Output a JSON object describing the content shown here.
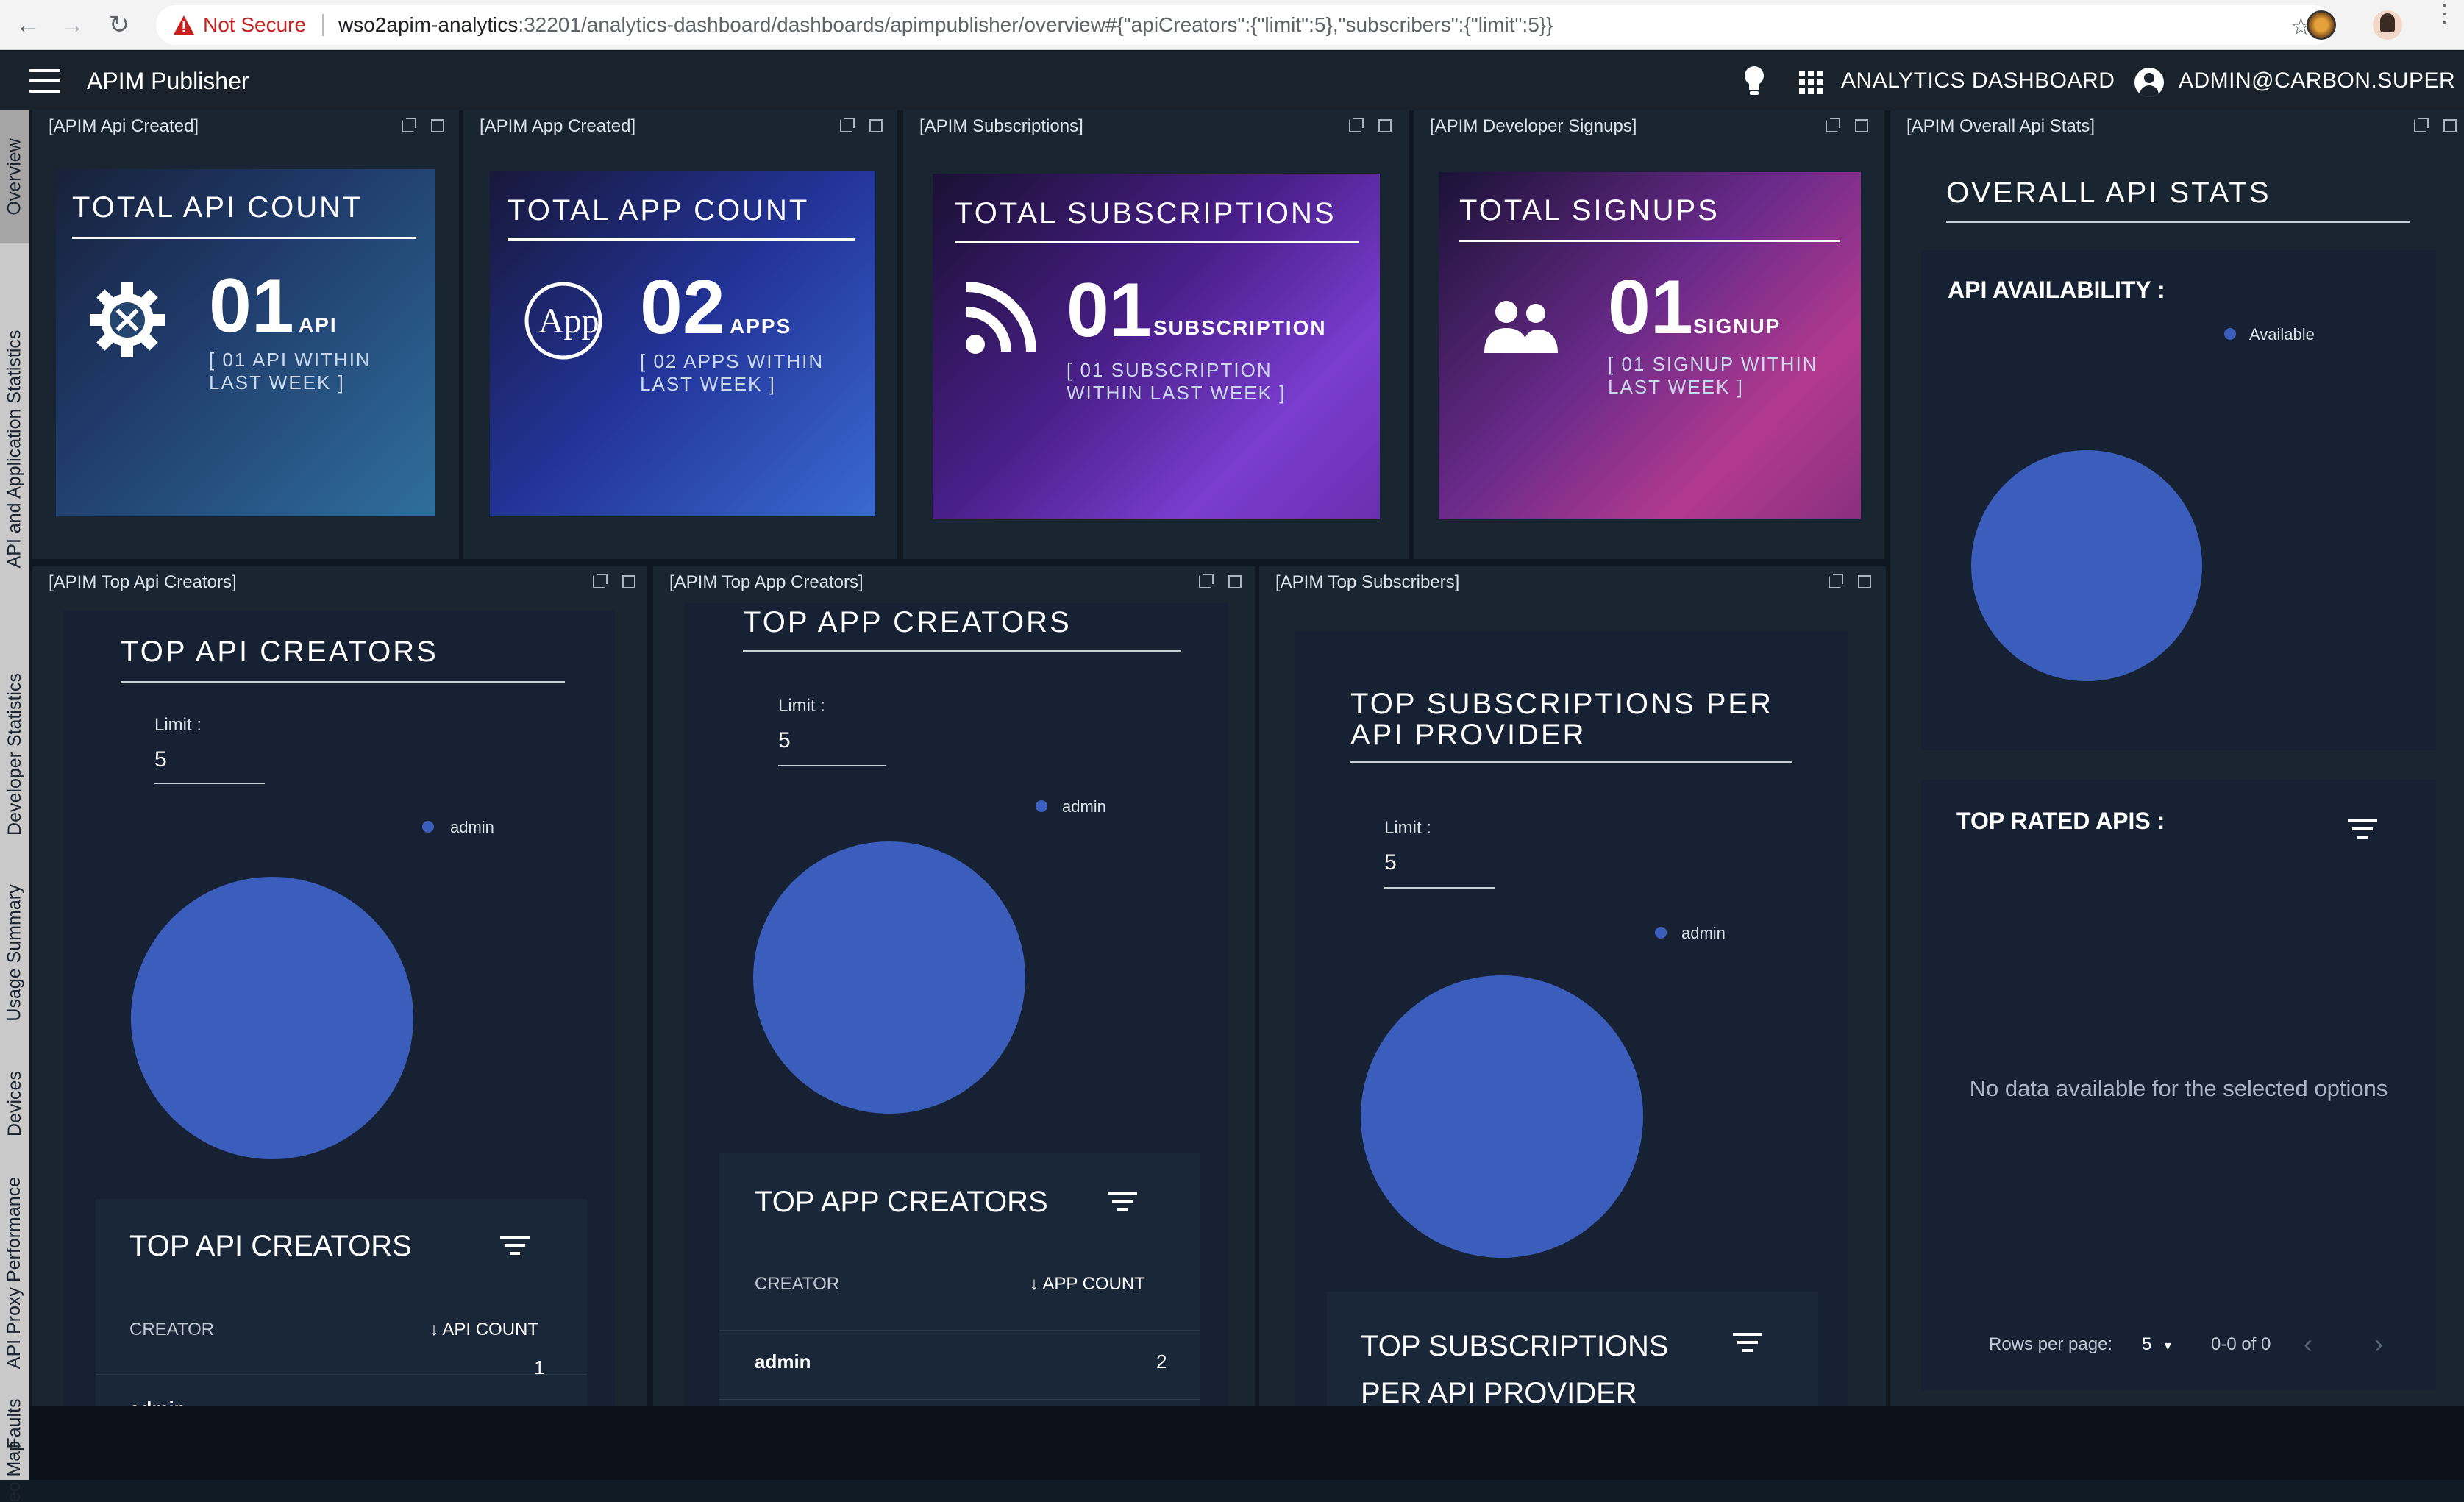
{
  "browser": {
    "security_label": "Not Secure",
    "url_host": "wso2apim-analytics",
    "url_rest": ":32201/analytics-dashboard/dashboards/apimpublisher/overview#{\"apiCreators\":{\"limit\":5},\"subscribers\":{\"limit\":5}}"
  },
  "header": {
    "title": "APIM Publisher",
    "dashboard_label": "ANALYTICS DASHBOARD",
    "user_label": "ADMIN@CARBON.SUPER"
  },
  "sidebar": {
    "tabs": [
      {
        "label": "Overview",
        "active": true
      },
      {
        "label": "API and Application Statistics"
      },
      {
        "label": "Developer Statistics"
      },
      {
        "label": "Usage Summary"
      },
      {
        "label": "Devices"
      },
      {
        "label": "API Proxy Performance"
      },
      {
        "label": "Faults"
      },
      {
        "label": "eo Map"
      }
    ]
  },
  "widgets": {
    "api_created": {
      "title": "[APIM Api Created]",
      "card_title": "TOTAL API COUNT",
      "count": "01",
      "unit": "API",
      "sub": "[ 01 API WITHIN LAST WEEK ]"
    },
    "app_created": {
      "title": "[APIM App Created]",
      "card_title": "TOTAL APP COUNT",
      "count": "02",
      "unit": "APPS",
      "sub": "[ 02 APPS WITHIN LAST WEEK ]",
      "icon_text": "App"
    },
    "subscriptions": {
      "title": "[APIM Subscriptions]",
      "card_title": "TOTAL SUBSCRIPTIONS",
      "count": "01",
      "unit": "SUBSCRIPTION",
      "sub": "[ 01 SUBSCRIPTION WITHIN LAST WEEK ]"
    },
    "signups": {
      "title": "[APIM Developer Signups]",
      "card_title": "TOTAL SIGNUPS",
      "count": "01",
      "unit": "SIGNUP",
      "sub": "[ 01 SIGNUP WITHIN LAST WEEK ]"
    },
    "overall": {
      "title": "[APIM Overall Api Stats]",
      "heading": "OVERALL API STATS",
      "availability_label": "API AVAILABILITY :",
      "legend": "Available",
      "top_rated_label": "TOP RATED APIS :",
      "no_data": "No data available for the selected options",
      "rows_per_page_label": "Rows per page:",
      "rows_per_page_value": "5",
      "range": "0-0 of 0"
    },
    "top_api": {
      "title": "[APIM Top Api Creators]",
      "heading": "TOP API CREATORS",
      "limit_label": "Limit :",
      "limit_value": "5",
      "legend": "admin",
      "table_title": "TOP API CREATORS",
      "col_creator": "CREATOR",
      "col_count": "API COUNT",
      "rows": [
        {
          "name": "admin",
          "count": "1"
        }
      ]
    },
    "top_app": {
      "title": "[APIM Top App Creators]",
      "heading": "TOP APP CREATORS",
      "limit_label": "Limit :",
      "limit_value": "5",
      "legend": "admin",
      "table_title": "TOP APP CREATORS",
      "col_creator": "CREATOR",
      "col_count": "APP COUNT",
      "rows": [
        {
          "name": "admin",
          "count": "2"
        }
      ]
    },
    "top_subs": {
      "title": "[APIM Top Subscribers]",
      "heading_line1": "TOP SUBSCRIPTIONS PER",
      "heading_line2": "API PROVIDER",
      "limit_label": "Limit :",
      "limit_value": "5",
      "legend": "admin",
      "table_title_line1": "TOP SUBSCRIPTIONS",
      "table_title_line2": "PER API PROVIDER"
    }
  },
  "colors": {
    "pie": "#3b5ebd",
    "bg": "#0f1821",
    "widget": "#1a2532"
  }
}
